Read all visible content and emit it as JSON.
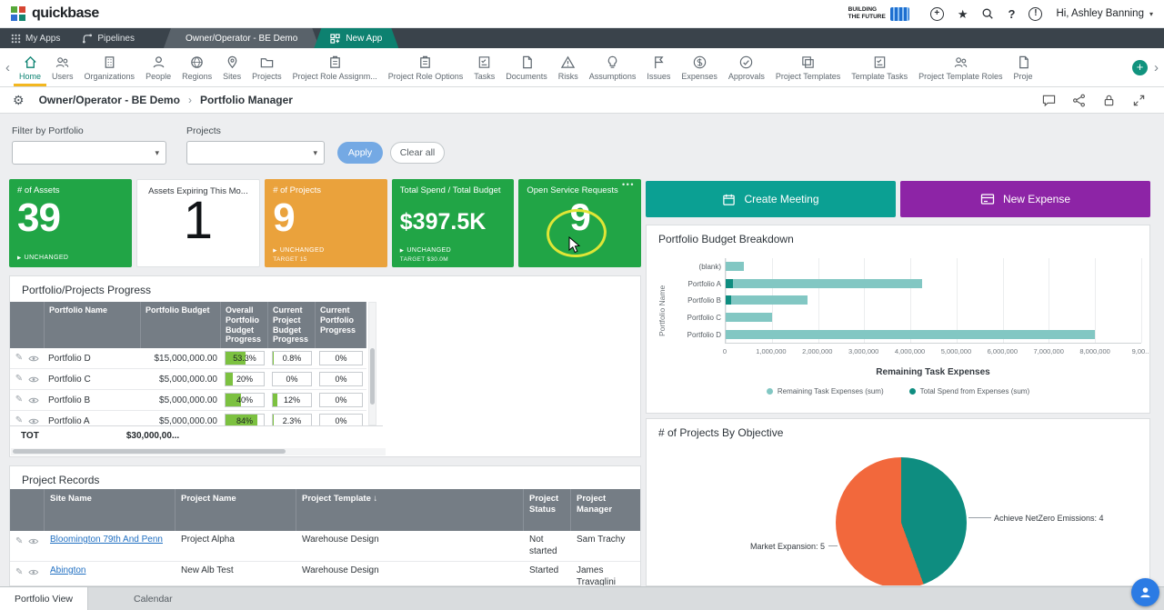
{
  "topbar": {
    "logo_text": "quickbase",
    "customer_logo_line1": "BUILDING",
    "customer_logo_line2": "THE FUTURE",
    "greeting": "Hi, Ashley Banning"
  },
  "navbar": {
    "my_apps": "My Apps",
    "pipelines": "Pipelines",
    "app_tab": "Owner/Operator - BE Demo",
    "new_app": "New App"
  },
  "nav": {
    "items": [
      {
        "label": "Home",
        "icon": "#i-home",
        "cls": "active"
      },
      {
        "label": "Users",
        "icon": "#i-users",
        "cls": ""
      },
      {
        "label": "Organizations",
        "icon": "#i-building",
        "cls": ""
      },
      {
        "label": "People",
        "icon": "#i-user",
        "cls": ""
      },
      {
        "label": "Regions",
        "icon": "#i-globe",
        "cls": ""
      },
      {
        "label": "Sites",
        "icon": "#i-pin",
        "cls": ""
      },
      {
        "label": "Projects",
        "icon": "#i-folder",
        "cls": ""
      },
      {
        "label": "Project Role Assignm...",
        "icon": "#i-clipboard",
        "cls": ""
      },
      {
        "label": "Project Role Options",
        "icon": "#i-clipboard",
        "cls": ""
      },
      {
        "label": "Tasks",
        "icon": "#i-task",
        "cls": ""
      },
      {
        "label": "Documents",
        "icon": "#i-doc",
        "cls": ""
      },
      {
        "label": "Risks",
        "icon": "#i-warning",
        "cls": ""
      },
      {
        "label": "Assumptions",
        "icon": "#i-bulb",
        "cls": ""
      },
      {
        "label": "Issues",
        "icon": "#i-flag",
        "cls": ""
      },
      {
        "label": "Expenses",
        "icon": "#i-dollar",
        "cls": ""
      },
      {
        "label": "Approvals",
        "icon": "#i-check",
        "cls": ""
      },
      {
        "label": "Project Templates",
        "icon": "#i-copy",
        "cls": ""
      },
      {
        "label": "Template Tasks",
        "icon": "#i-task",
        "cls": ""
      },
      {
        "label": "Project Template Roles",
        "icon": "#i-users",
        "cls": ""
      },
      {
        "label": "Proje",
        "icon": "#i-doc",
        "cls": ""
      }
    ]
  },
  "breadcrumb": {
    "app": "Owner/Operator - BE Demo",
    "sep": "›",
    "page": "Portfolio Manager"
  },
  "filters": {
    "portfolio_label": "Filter by Portfolio",
    "portfolio_value": "",
    "projects_label": "Projects",
    "projects_value": "",
    "apply_label": "Apply",
    "clear_label": "Clear all"
  },
  "kpis": [
    {
      "title": "# of Assets",
      "value": "39",
      "status": "UNCHANGED"
    },
    {
      "title": "Assets Expiring This Mo...",
      "value": "1"
    },
    {
      "title": "# of Projects",
      "value": "9",
      "status": "UNCHANGED",
      "target": "TARGET 15"
    },
    {
      "title": "Total Spend / Total Budget",
      "value": "$397.5K",
      "status": "UNCHANGED",
      "target": "TARGET $30.0M"
    },
    {
      "title": "Open Service Requests",
      "value": "9",
      "menu": "•••"
    }
  ],
  "actions": [
    {
      "label": "Create Meeting",
      "color": "#0ba093"
    },
    {
      "label": "New Expense",
      "color": "#8d24a6"
    }
  ],
  "progress_table": {
    "title": "Portfolio/Projects Progress",
    "headers": [
      "Portfolio Name",
      "Portfolio Budget",
      "Overall Portfolio Budget Progress",
      "Current Project Budget Progress",
      "Current Portfolio Progress"
    ],
    "rows": [
      {
        "name": "Portfolio D",
        "budget": "$15,000,000.00",
        "overall": "53.3%",
        "overall_pct": 53.3,
        "proj": "0.8%",
        "proj_pct": 0.8,
        "port": "0%",
        "port_pct": 0
      },
      {
        "name": "Portfolio C",
        "budget": "$5,000,000.00",
        "overall": "20%",
        "overall_pct": 20,
        "proj": "0%",
        "proj_pct": 0,
        "port": "0%",
        "port_pct": 0
      },
      {
        "name": "Portfolio B",
        "budget": "$5,000,000.00",
        "overall": "40%",
        "overall_pct": 40,
        "proj": "12%",
        "proj_pct": 12,
        "port": "0%",
        "port_pct": 0
      },
      {
        "name": "Portfolio A",
        "budget": "$5,000,000.00",
        "overall": "84%",
        "overall_pct": 84,
        "proj": "2.3%",
        "proj_pct": 2.3,
        "port": "0%",
        "port_pct": 0
      }
    ],
    "total_label": "TOT",
    "total_budget": "$30,000,00..."
  },
  "records_table": {
    "title": "Project Records",
    "headers": [
      "Site Name",
      "Project Name",
      "Project Template",
      "Project Status",
      "Project Manager"
    ],
    "sort_icon": "↓",
    "rows": [
      {
        "site": "Bloomington 79th And Penn",
        "project": "Project Alpha",
        "template": "Warehouse Design",
        "status": "Not started",
        "manager": "Sam Trachy"
      },
      {
        "site": "Abington",
        "project": "New Alb Test",
        "template": "Warehouse Design",
        "status": "Started",
        "manager": "James Travaglini"
      }
    ]
  },
  "chart_data": [
    {
      "type": "bar",
      "orientation": "horizontal",
      "title": "Portfolio Budget Breakdown",
      "categories": [
        "(blank)",
        "Portfolio A",
        "Portfolio B",
        "Portfolio C",
        "Portfolio D"
      ],
      "series": [
        {
          "name": "Remaining Task Expenses (sum)",
          "color": "#82c7c3",
          "values": [
            400000,
            4100000,
            1650000,
            1000000,
            8000000
          ]
        },
        {
          "name": "Total Spend from Expenses (sum)",
          "color": "#0e8d80",
          "values": [
            0,
            150000,
            120000,
            0,
            0
          ]
        }
      ],
      "xlabel": "Remaining Task Expenses",
      "ylabel": "Portfolio Name",
      "xlim": [
        0,
        9000000
      ],
      "xticks": [
        "0",
        "1,000,000",
        "2,000,000",
        "3,000,000",
        "4,000,000",
        "5,000,000",
        "6,000,000",
        "7,000,000",
        "8,000,000",
        "9,00..."
      ],
      "grid": true,
      "legend_position": "bottom"
    },
    {
      "type": "pie",
      "title": "# of Projects By Objective",
      "labels": [
        "Market Expansion: 5",
        "Achieve NetZero Emissions: 4"
      ],
      "values": [
        5,
        4
      ],
      "colors": [
        "#f2683c",
        "#0e8d80"
      ],
      "start_angle": 160
    }
  ],
  "footer": {
    "tabs": [
      "Portfolio View",
      "Calendar"
    ]
  },
  "glyphs": {
    "caret_down": "▾",
    "chevron_left": "‹",
    "chevron_right": "›",
    "plus": "+",
    "status_triangle": "▶",
    "pencil": "✎",
    "question": "?",
    "exclamation": "!",
    "star": "★",
    "gear": "⚙",
    "tot": "TOT"
  },
  "colors": {
    "accent_teal": "#0ba093",
    "accent_purple": "#8d24a6",
    "kpi_green": "#21a546",
    "kpi_amber": "#eaa23c",
    "progress_green": "#7cc140",
    "link_blue": "#2170c2",
    "highlight_yellow": "#dfe636"
  }
}
